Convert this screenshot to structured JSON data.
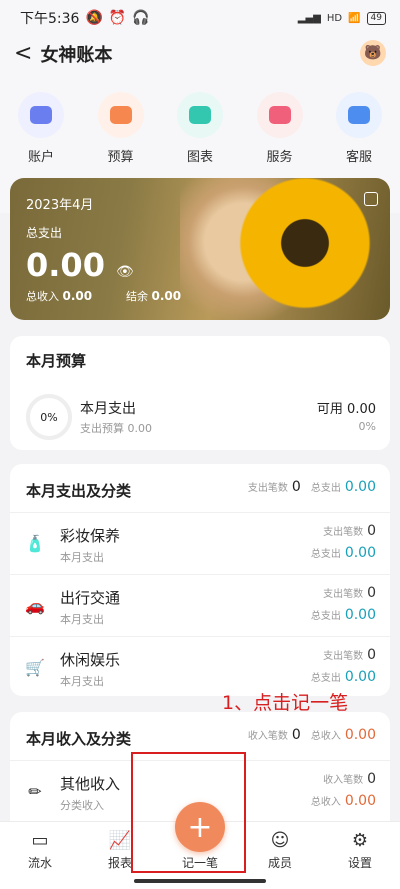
{
  "status": {
    "time": "下午5:36",
    "battery": "49",
    "signal": "HD"
  },
  "header": {
    "title": "女神账本",
    "back": "<"
  },
  "quick_actions": [
    {
      "label": "账户",
      "color": "#eef0ff",
      "inner": "#6a7ef0"
    },
    {
      "label": "预算",
      "color": "#fff1ea",
      "inner": "#f5874f"
    },
    {
      "label": "图表",
      "color": "#e7f8f5",
      "inner": "#33c7b0"
    },
    {
      "label": "服务",
      "color": "#fdeeee",
      "inner": "#f0607a"
    },
    {
      "label": "客服",
      "color": "#eaf1ff",
      "inner": "#4d8df0"
    }
  ],
  "summary": {
    "month": "2023年4月",
    "spend_label": "总支出",
    "spend_value": "0.00",
    "income_label": "总收入",
    "income_value": "0.00",
    "balance_label": "结余",
    "balance_value": "0.00"
  },
  "budget": {
    "title": "本月预算",
    "percent": "0%",
    "name": "本月支出",
    "sub": "支出预算 0.00",
    "available": "可用 0.00",
    "pct": "0%"
  },
  "expense": {
    "title": "本月支出及分类",
    "count_label": "支出笔数",
    "count": "0",
    "total_label": "总支出",
    "total": "0.00",
    "rows": [
      {
        "name": "彩妆保养",
        "sub": "本月支出",
        "count_label": "支出笔数",
        "count": "0",
        "total_label": "总支出",
        "total": "0.00",
        "icon": "🧴"
      },
      {
        "name": "出行交通",
        "sub": "本月支出",
        "count_label": "支出笔数",
        "count": "0",
        "total_label": "总支出",
        "total": "0.00",
        "icon": "🚗"
      },
      {
        "name": "休闲娱乐",
        "sub": "本月支出",
        "count_label": "支出笔数",
        "count": "0",
        "total_label": "总支出",
        "total": "0.00",
        "icon": "🛒"
      }
    ]
  },
  "income": {
    "title": "本月收入及分类",
    "count_label": "收入笔数",
    "count": "0",
    "total_label": "总收入",
    "total": "0.00",
    "rows": [
      {
        "name": "其他收入",
        "sub": "分类收入",
        "count_label": "收入笔数",
        "count": "0",
        "total_label": "总收入",
        "total": "0.00",
        "icon": "✏"
      }
    ]
  },
  "annotation": "1、点击记一笔",
  "tabbar": [
    {
      "label": "流水",
      "icon": "▭"
    },
    {
      "label": "报表",
      "icon": "📈"
    },
    {
      "label": "记一笔",
      "icon": "+"
    },
    {
      "label": "成员",
      "icon": "☺"
    },
    {
      "label": "设置",
      "icon": "⚙"
    }
  ]
}
